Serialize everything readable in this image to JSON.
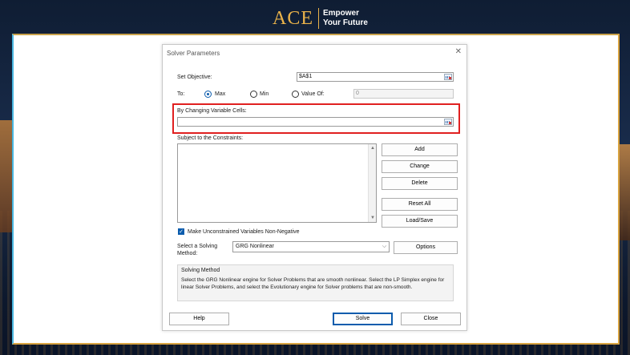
{
  "brand": {
    "logo": "ACE",
    "line1": "Empower",
    "line2": "Your Future"
  },
  "dialog": {
    "title": "Solver Parameters",
    "close_icon": "close-icon",
    "set_objective_label": "Set Objective:",
    "set_objective_value": "$A$1",
    "to_label": "To:",
    "options": {
      "max": "Max",
      "min": "Min",
      "value_of": "Value Of:"
    },
    "selected_option": "Max",
    "value_of_value": "0",
    "changing_cells_label": "By Changing Variable Cells:",
    "changing_cells_value": "",
    "constraints_label": "Subject to the Constraints:",
    "constraints": [],
    "buttons": {
      "add": "Add",
      "change": "Change",
      "delete": "Delete",
      "reset_all": "Reset All",
      "load_save": "Load/Save",
      "options": "Options",
      "help": "Help",
      "solve": "Solve",
      "close": "Close"
    },
    "unconstrained_label": "Make Unconstrained Variables Non-Negative",
    "unconstrained_checked": true,
    "solving_method_label_1": "Select a Solving",
    "solving_method_label_2": "Method:",
    "solving_method_value": "GRG Nonlinear",
    "method_group_title": "Solving Method",
    "method_group_text": "Select the GRG Nonlinear engine for Solver Problems that are smooth nonlinear. Select the LP Simplex engine for linear Solver Problems, and select the Evolutionary engine for Solver problems that are non-smooth."
  },
  "colors": {
    "accent": "#0b5cad",
    "highlight": "#e02020",
    "brand_gold": "#e9b24a"
  }
}
